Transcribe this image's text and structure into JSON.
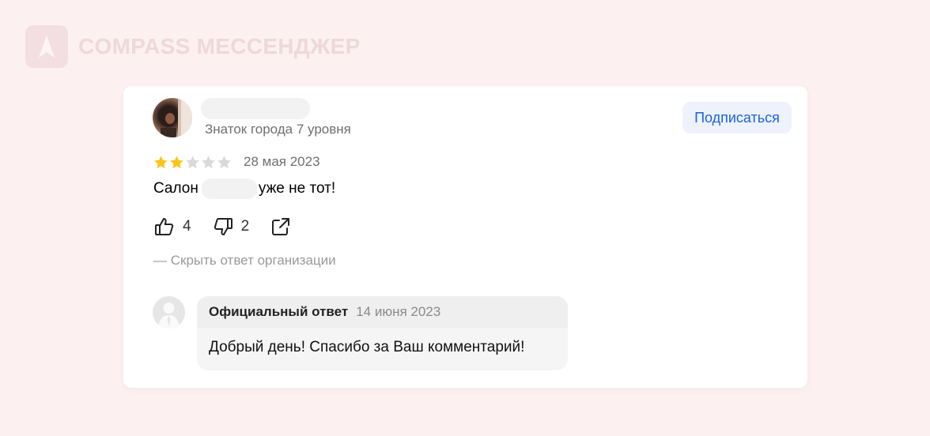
{
  "brand": {
    "name": "COMPASS МЕССЕНДЖЕР",
    "logo_icon": "compass-arrow-icon",
    "text_color": "#eed8da"
  },
  "review": {
    "author_badge": "Знаток города 7 уровня",
    "subscribe_label": "Подписаться",
    "rating": 2,
    "rating_max": 5,
    "date": "28 мая 2023",
    "text_before": "Салон",
    "text_after": "уже не тот!",
    "likes": "4",
    "dislikes": "2",
    "share_icon": "share-icon",
    "hide_reply_label": "— Скрыть ответ организации"
  },
  "org_reply": {
    "title": "Официальный ответ",
    "date": "14 июня 2023",
    "text": "Добрый день! Спасибо за Ваш комментарий!"
  },
  "colors": {
    "star_filled": "#fcc419",
    "star_empty": "#d9d9d9",
    "accent_blue": "#1e62d9",
    "page_bg": "#fdf0f0"
  }
}
